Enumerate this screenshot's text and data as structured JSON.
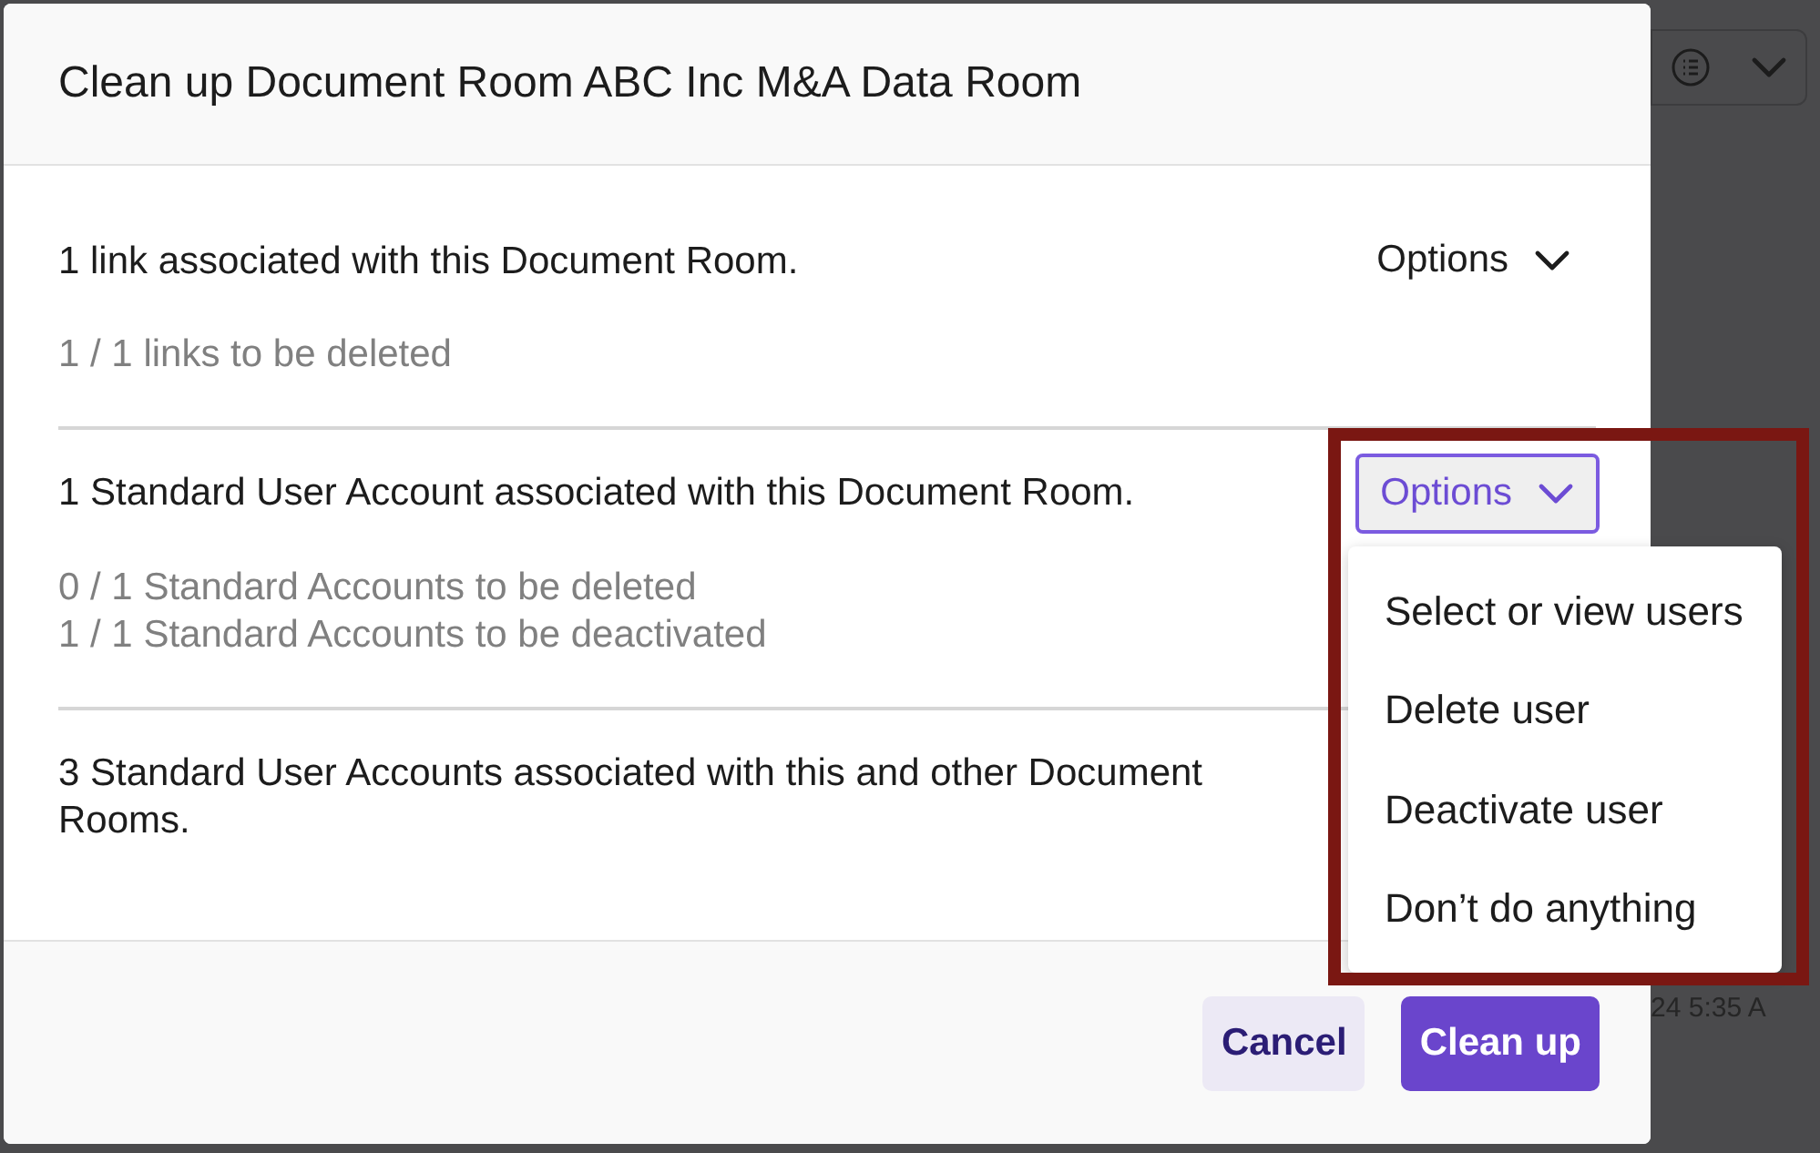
{
  "background": {
    "timestamp": "24 5:35 A"
  },
  "dialog": {
    "title": "Clean up Document Room ABC Inc M&A Data Room",
    "sections": [
      {
        "heading": "1 link associated with this Document Room.",
        "details": [
          "1 / 1 links to be deleted"
        ],
        "options": {
          "label": "Options",
          "expanded": false
        }
      },
      {
        "heading": "1 Standard User Account associated with this Document Room.",
        "details": [
          "0 / 1 Standard Accounts to be deleted",
          "1 / 1 Standard Accounts to be deactivated"
        ],
        "options": {
          "label": "Options",
          "expanded": true
        }
      },
      {
        "heading": "3 Standard User Accounts associated with this and other Document Rooms."
      }
    ],
    "menu": [
      "Select or view users",
      "Delete user",
      "Deactivate user",
      "Don’t do anything"
    ],
    "buttons": [
      {
        "label": "Cancel",
        "kind": "secondary"
      },
      {
        "label": "Clean up",
        "kind": "primary"
      }
    ]
  }
}
